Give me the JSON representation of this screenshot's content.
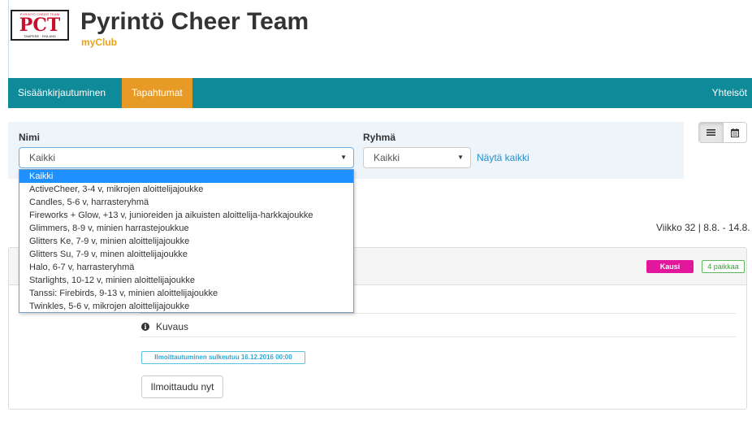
{
  "header": {
    "logo_top": "PYRINTÖ CHEER TEAM",
    "logo_letters": "PCT",
    "logo_bottom": "TAMPERE · FINLAND",
    "title": "Pyrintö Cheer Team",
    "subtitle": "myClub"
  },
  "nav": {
    "login": "Sisäänkirjautuminen",
    "events": "Tapahtumat",
    "community": "Yhteisöt"
  },
  "filters": {
    "name_label": "Nimi",
    "name_value": "Kaikki",
    "group_label": "Ryhmä",
    "group_value": "Kaikki",
    "show_all": "Näytä kaikki",
    "caret": "▼"
  },
  "dropdown": {
    "options": [
      "Kaikki",
      "ActiveCheer, 3-4 v, mikrojen aloittelijajoukke",
      "Candles, 5-6 v, harrasteryhmä",
      "Fireworks + Glow, +13 v, junioreiden ja aikuisten aloittelija-harkkajoukke",
      "Glimmers, 8-9 v, minien harrastejoukkue",
      "Glitters Ke, 7-9 v, minien aloittelijajoukke",
      "Glitters Su, 7-9 v, minen aloittelijajoukke",
      "Halo, 6-7 v, harrasteryhmä",
      "Starlights, 10-12 v, minien aloittelijajoukke",
      "Tanssi: Firebirds, 9-13 v, minien aloittelijajoukke",
      "Twinkles, 5-6 v, mikrojen aloittelijajoukke"
    ]
  },
  "week": "Viikko 32 | 8.8. - 14.8.",
  "event": {
    "badge_season": "Kausi",
    "badge_places": "4 paikkaa",
    "description": "Kuvaus",
    "closing": "Ilmoittautuminen sulkeutuu 16.12.2016 00:00",
    "signup": "Ilmoittaudu nyt"
  },
  "colors": {
    "nav_bg": "#0e8a99",
    "nav_active": "#e89a26",
    "badge_season": "#e3179b",
    "selected_option": "#1e90ff"
  },
  "icons": {
    "list": "list-icon",
    "calendar": "calendar-icon",
    "info": "info-icon"
  }
}
